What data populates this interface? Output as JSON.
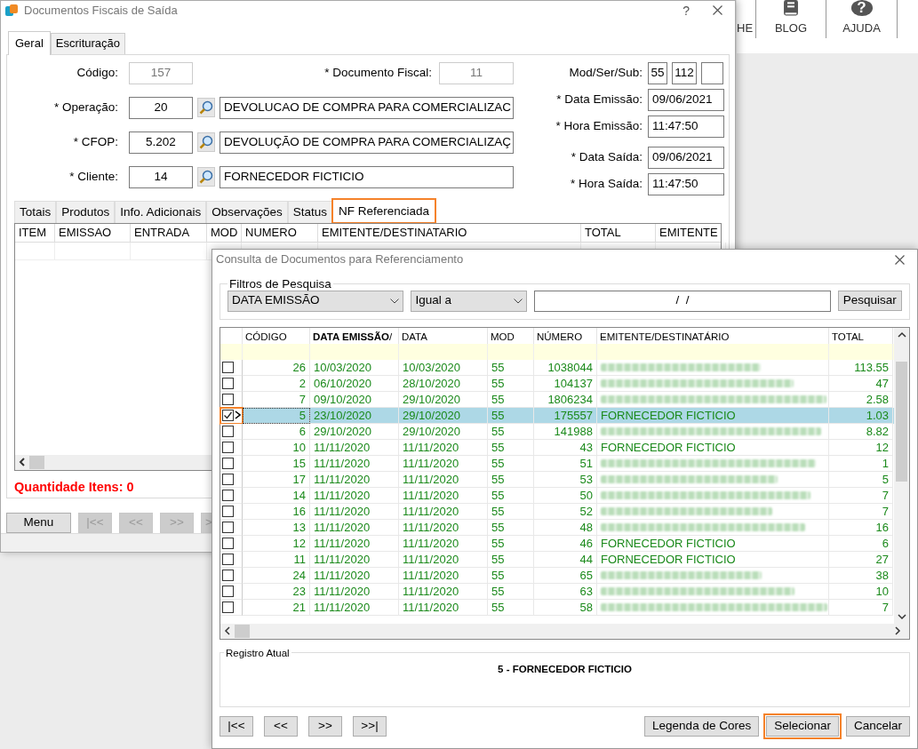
{
  "background_app": {
    "toolbar": [
      {
        "label": "HE",
        "kind": "plain"
      },
      {
        "label": "BLOG",
        "kind": "book"
      },
      {
        "label": "AJUDA",
        "kind": "help",
        "glyph": "?"
      }
    ]
  },
  "main_window": {
    "title": "Documentos Fiscais de Saída",
    "help": "?",
    "tabs": [
      {
        "label": "Geral",
        "selected": true
      },
      {
        "label": "Escrituração",
        "selected": false
      }
    ],
    "form": {
      "codigo": {
        "label": "Código:",
        "value": "157",
        "disabled": true
      },
      "documento_fiscal": {
        "label": "* Documento Fiscal:",
        "value": "11",
        "disabled": true
      },
      "lookups": [
        {
          "label": "* Operação:",
          "value": "20",
          "description": "DEVOLUCAO DE COMPRA PARA COMERCIALIZAC"
        },
        {
          "label": "* CFOP:",
          "value": "5.202",
          "description": "DEVOLUÇÃO DE COMPRA PARA COMERCIALIZAÇ"
        },
        {
          "label": "* Cliente:",
          "value": "14",
          "description": "FORNECEDOR FICTICIO"
        }
      ],
      "mod_ser_sub": {
        "label": "Mod/Ser/Sub:",
        "values": [
          "55",
          "112"
        ]
      },
      "dates": [
        {
          "label": "* Data Emissão:",
          "value": "09/06/2021"
        },
        {
          "label": "* Hora Emissão:",
          "value": "11:47:50"
        },
        {
          "label": "* Data Saída:",
          "value": "09/06/2021"
        },
        {
          "label": "* Hora Saída:",
          "value": "11:47:50"
        }
      ]
    },
    "sub_tabs": [
      {
        "label": "Totais",
        "selected": false,
        "highlighted": false
      },
      {
        "label": "Produtos",
        "selected": false,
        "highlighted": false
      },
      {
        "label": "Info. Adicionais",
        "selected": false,
        "highlighted": false
      },
      {
        "label": "Observações",
        "selected": false,
        "highlighted": false
      },
      {
        "label": "Status",
        "selected": false,
        "highlighted": false
      },
      {
        "label": "NF Referenciada",
        "selected": true,
        "highlighted": true
      }
    ],
    "items_grid": {
      "columns": [
        "ITEM",
        "EMISSAO",
        "ENTRADA",
        "MOD",
        "NUMERO",
        "EMITENTE/DESTINATARIO",
        "TOTAL",
        "EMITENTE"
      ]
    },
    "quantity": "Quantidade Itens: 0",
    "nav_buttons": [
      {
        "label": "Menu",
        "disabled": false
      },
      {
        "label": "|<<",
        "disabled": true
      },
      {
        "label": "<<",
        "disabled": true
      },
      {
        "label": ">>",
        "disabled": true
      },
      {
        "label": ">",
        "disabled": true
      }
    ]
  },
  "dialog": {
    "title": "Consulta de Documentos para Referenciamento",
    "filters": {
      "legend": "Filtros de Pesquisa",
      "field": "DATA EMISSÃO",
      "operator": "Igual a",
      "value": "/  /",
      "search_button": "Pesquisar"
    },
    "table": {
      "columns": [
        "CÓDIGO",
        "**DATA EMISSÃO**/",
        "DATA",
        "MOD",
        "NÚMERO",
        "EMITENTE/DESTINATÁRIO",
        "TOTAL"
      ],
      "rows": [
        {
          "checked": false,
          "selected": false,
          "highlighted": false,
          "codigo": "26",
          "data_emissao": "10/03/2020",
          "data": "10/03/2020",
          "mod": "55",
          "numero": "1038044",
          "blurred": true,
          "total": "113.55"
        },
        {
          "checked": false,
          "selected": false,
          "highlighted": false,
          "codigo": "2",
          "data_emissao": "06/10/2020",
          "data": "28/10/2020",
          "mod": "55",
          "numero": "104137",
          "blurred": true,
          "total": "47"
        },
        {
          "checked": false,
          "selected": false,
          "highlighted": false,
          "codigo": "7",
          "data_emissao": "09/10/2020",
          "data": "29/10/2020",
          "mod": "55",
          "numero": "1806234",
          "blurred": true,
          "total": "2.58"
        },
        {
          "checked": true,
          "selected": true,
          "highlighted": true,
          "codigo": "5",
          "data_emissao": "23/10/2020",
          "data": "29/10/2020",
          "mod": "55",
          "numero": "175557",
          "blurred": false,
          "emitente": "FORNECEDOR FICTICIO",
          "total": "1.03"
        },
        {
          "checked": false,
          "selected": false,
          "highlighted": false,
          "codigo": "6",
          "data_emissao": "29/10/2020",
          "data": "29/10/2020",
          "mod": "55",
          "numero": "141988",
          "blurred": true,
          "total": "8.82"
        },
        {
          "checked": false,
          "selected": false,
          "highlighted": false,
          "codigo": "10",
          "data_emissao": "11/11/2020",
          "data": "11/11/2020",
          "mod": "55",
          "numero": "43",
          "blurred": false,
          "emitente": "FORNECEDOR FICTICIO",
          "total": "12"
        },
        {
          "checked": false,
          "selected": false,
          "highlighted": false,
          "codigo": "15",
          "data_emissao": "11/11/2020",
          "data": "11/11/2020",
          "mod": "55",
          "numero": "51",
          "blurred": true,
          "total": "1"
        },
        {
          "checked": false,
          "selected": false,
          "highlighted": false,
          "codigo": "17",
          "data_emissao": "11/11/2020",
          "data": "11/11/2020",
          "mod": "55",
          "numero": "53",
          "blurred": true,
          "total": "5"
        },
        {
          "checked": false,
          "selected": false,
          "highlighted": false,
          "codigo": "14",
          "data_emissao": "11/11/2020",
          "data": "11/11/2020",
          "mod": "55",
          "numero": "50",
          "blurred": true,
          "total": "7"
        },
        {
          "checked": false,
          "selected": false,
          "highlighted": false,
          "codigo": "16",
          "data_emissao": "11/11/2020",
          "data": "11/11/2020",
          "mod": "55",
          "numero": "52",
          "blurred": true,
          "total": "7"
        },
        {
          "checked": false,
          "selected": false,
          "highlighted": false,
          "codigo": "13",
          "data_emissao": "11/11/2020",
          "data": "11/11/2020",
          "mod": "55",
          "numero": "48",
          "blurred": true,
          "total": "16"
        },
        {
          "checked": false,
          "selected": false,
          "highlighted": false,
          "codigo": "12",
          "data_emissao": "11/11/2020",
          "data": "11/11/2020",
          "mod": "55",
          "numero": "46",
          "blurred": false,
          "emitente": "FORNECEDOR FICTICIO",
          "total": "6"
        },
        {
          "checked": false,
          "selected": false,
          "highlighted": false,
          "codigo": "11",
          "data_emissao": "11/11/2020",
          "data": "11/11/2020",
          "mod": "55",
          "numero": "44",
          "blurred": false,
          "emitente": "FORNECEDOR FICTICIO",
          "total": "27"
        },
        {
          "checked": false,
          "selected": false,
          "highlighted": false,
          "codigo": "24",
          "data_emissao": "11/11/2020",
          "data": "11/11/2020",
          "mod": "55",
          "numero": "65",
          "blurred": true,
          "total": "38"
        },
        {
          "checked": false,
          "selected": false,
          "highlighted": false,
          "codigo": "23",
          "data_emissao": "11/11/2020",
          "data": "11/11/2020",
          "mod": "55",
          "numero": "63",
          "blurred": true,
          "total": "10"
        },
        {
          "checked": false,
          "selected": false,
          "highlighted": false,
          "codigo": "21",
          "data_emissao": "11/11/2020",
          "data": "11/11/2020",
          "mod": "55",
          "numero": "58",
          "blurred": true,
          "total": "7"
        }
      ]
    },
    "current_record": {
      "legend": "Registro Atual",
      "value": "5 - FORNECEDOR FICTICIO"
    },
    "nav_buttons": [
      "|<<",
      "<<",
      ">>",
      ">>|"
    ],
    "actions": [
      {
        "label": "Legenda de Cores",
        "highlighted": false
      },
      {
        "label": "Selecionar",
        "highlighted": true
      },
      {
        "label": "Cancelar",
        "highlighted": false
      }
    ]
  }
}
